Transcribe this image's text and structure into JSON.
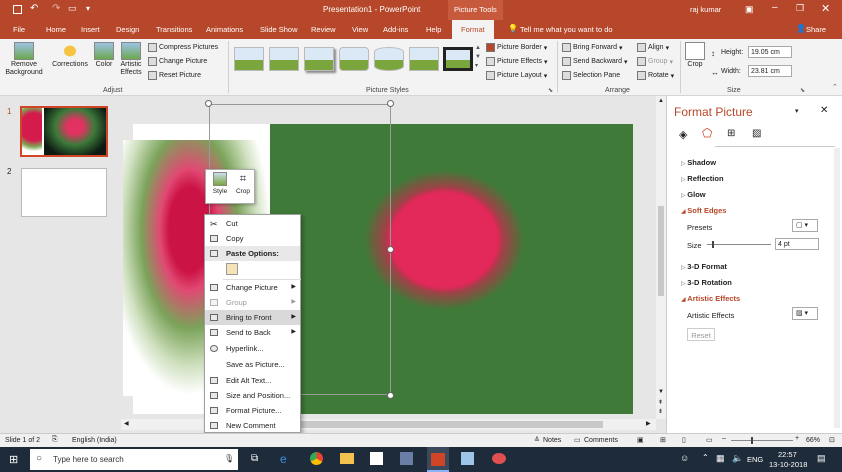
{
  "title_bar": {
    "window_title": "Presentation1 - PowerPoint",
    "context_tab": "Picture Tools",
    "user": "raj kumar",
    "qat_icons": [
      "save-icon",
      "undo-icon",
      "redo-icon",
      "present-icon"
    ]
  },
  "tabs": {
    "items": [
      "File",
      "Home",
      "Insert",
      "Design",
      "Transitions",
      "Animations",
      "Slide Show",
      "Review",
      "View",
      "Add-ins",
      "Help",
      "Format"
    ],
    "active": "Format",
    "tell_me": "Tell me what you want to do",
    "share": "Share"
  },
  "ribbon": {
    "adjust": {
      "remove_background": "Remove Background",
      "corrections": "Corrections",
      "color": "Color",
      "artistic_effects": "Artistic Effects",
      "compress": "Compress Pictures",
      "change": "Change Picture",
      "reset": "Reset Picture",
      "label": "Adjust"
    },
    "styles": {
      "label": "Picture Styles",
      "border": "Picture Border",
      "effects": "Picture Effects",
      "layout": "Picture Layout"
    },
    "arrange": {
      "label": "Arrange",
      "bring_forward": "Bring Forward",
      "send_backward": "Send Backward",
      "selection_pane": "Selection Pane",
      "align": "Align",
      "group": "Group",
      "rotate": "Rotate"
    },
    "size": {
      "label": "Size",
      "crop": "Crop",
      "height_label": "Height:",
      "height_value": "19.05 cm",
      "width_label": "Width:",
      "width_value": "23.81 cm"
    }
  },
  "slides": [
    {
      "number": "1"
    },
    {
      "number": "2"
    }
  ],
  "mini_toolbar": {
    "style": "Style",
    "crop": "Crop"
  },
  "context_menu": {
    "items": [
      {
        "label": "Cut",
        "enabled": true,
        "icon": "scissors-icon"
      },
      {
        "label": "Copy",
        "enabled": true,
        "icon": "copy-icon"
      },
      {
        "label": "Paste Options:",
        "enabled": true,
        "header": true,
        "icon": "paste-icon"
      },
      {
        "label": "Change Picture",
        "enabled": true,
        "submenu": true,
        "icon": "change-picture-icon"
      },
      {
        "label": "Group",
        "enabled": false,
        "submenu": true,
        "icon": "group-icon"
      },
      {
        "label": "Bring to Front",
        "enabled": true,
        "submenu": true,
        "highlight": true,
        "icon": "bring-front-icon"
      },
      {
        "label": "Send to Back",
        "enabled": true,
        "submenu": true,
        "icon": "send-back-icon"
      },
      {
        "label": "Hyperlink...",
        "enabled": true,
        "icon": "hyperlink-icon"
      },
      {
        "label": "Save as Picture...",
        "enabled": true,
        "icon": ""
      },
      {
        "label": "Edit Alt Text...",
        "enabled": true,
        "icon": "alt-text-icon"
      },
      {
        "label": "Size and Position...",
        "enabled": true,
        "icon": "size-position-icon"
      },
      {
        "label": "Format Picture...",
        "enabled": true,
        "icon": "format-picture-icon"
      },
      {
        "label": "New Comment",
        "enabled": true,
        "icon": "comment-icon"
      }
    ]
  },
  "format_pane": {
    "title": "Format Picture",
    "sections": {
      "shadow": "Shadow",
      "reflection": "Reflection",
      "glow": "Glow",
      "soft_edges": "Soft Edges",
      "presets": "Presets",
      "size": "Size",
      "size_value": "4 pt",
      "format_3d": "3-D Format",
      "rotation_3d": "3-D Rotation",
      "artistic_effects": "Artistic Effects",
      "artistic_effects_label": "Artistic Effects",
      "reset": "Reset"
    },
    "soft_edges_size_fraction": 0.08
  },
  "status": {
    "slide": "Slide 1 of 2",
    "language": "English (India)",
    "notes": "Notes",
    "comments": "Comments",
    "zoom": "66%"
  },
  "taskbar": {
    "search": "Type here to search",
    "lang": "ENG",
    "time": "22:57",
    "date": "13-10-2018"
  },
  "colors": {
    "accent": "#b7472a",
    "highlight": "#d04525"
  }
}
